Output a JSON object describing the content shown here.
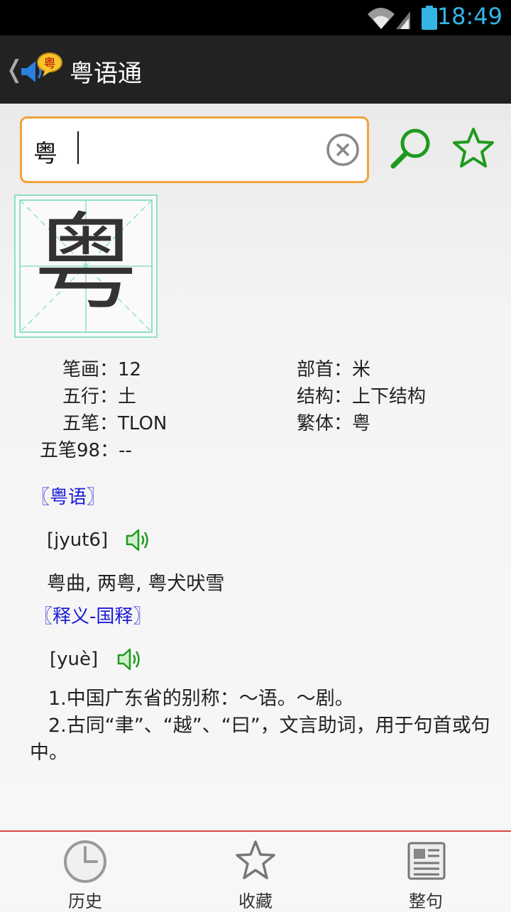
{
  "status_bar": {
    "time": "18:49",
    "time_color": "#33b5e5"
  },
  "app_bar": {
    "title": "粤语通",
    "logo_icon": "speaker-chat-icon",
    "logo_badge": "粤"
  },
  "search": {
    "value": "粤"
  },
  "character": {
    "glyph": "粤"
  },
  "info": {
    "strokes_label": "笔画：",
    "strokes_value": "12",
    "radical_label": "部首：",
    "radical_value": "米",
    "element_label": "五行：",
    "element_value": "土",
    "structure_label": "结构：",
    "structure_value": "上下结构",
    "wubi_label": "五笔：",
    "wubi_value": "TLON",
    "traditional_label": "繁体：",
    "traditional_value": "粤",
    "wubi98_label": "五笔98：",
    "wubi98_value": "--"
  },
  "cantonese": {
    "title": "〖粤语〗",
    "jyutping": "[jyut6]",
    "examples": "粤曲, 两粤, 粤犬吠雪"
  },
  "mandarin": {
    "title": "〖释义-国释〗",
    "pinyin": "[yuè]",
    "definitions": [
      "1.中国广东省的别称：～语。～剧。",
      "2.古同“聿”、“越”、“曰”，文言助词，用于句首或句中。"
    ]
  },
  "bottom_nav": [
    {
      "label": "历史",
      "icon": "clock-icon"
    },
    {
      "label": "收藏",
      "icon": "star-outline-icon"
    },
    {
      "label": "整句",
      "icon": "newspaper-icon"
    }
  ],
  "colors": {
    "accent_orange": "#f2a23a",
    "icon_green": "#1e9a1e",
    "section_blue": "#1a1ad8",
    "divider_red": "#d44444"
  }
}
